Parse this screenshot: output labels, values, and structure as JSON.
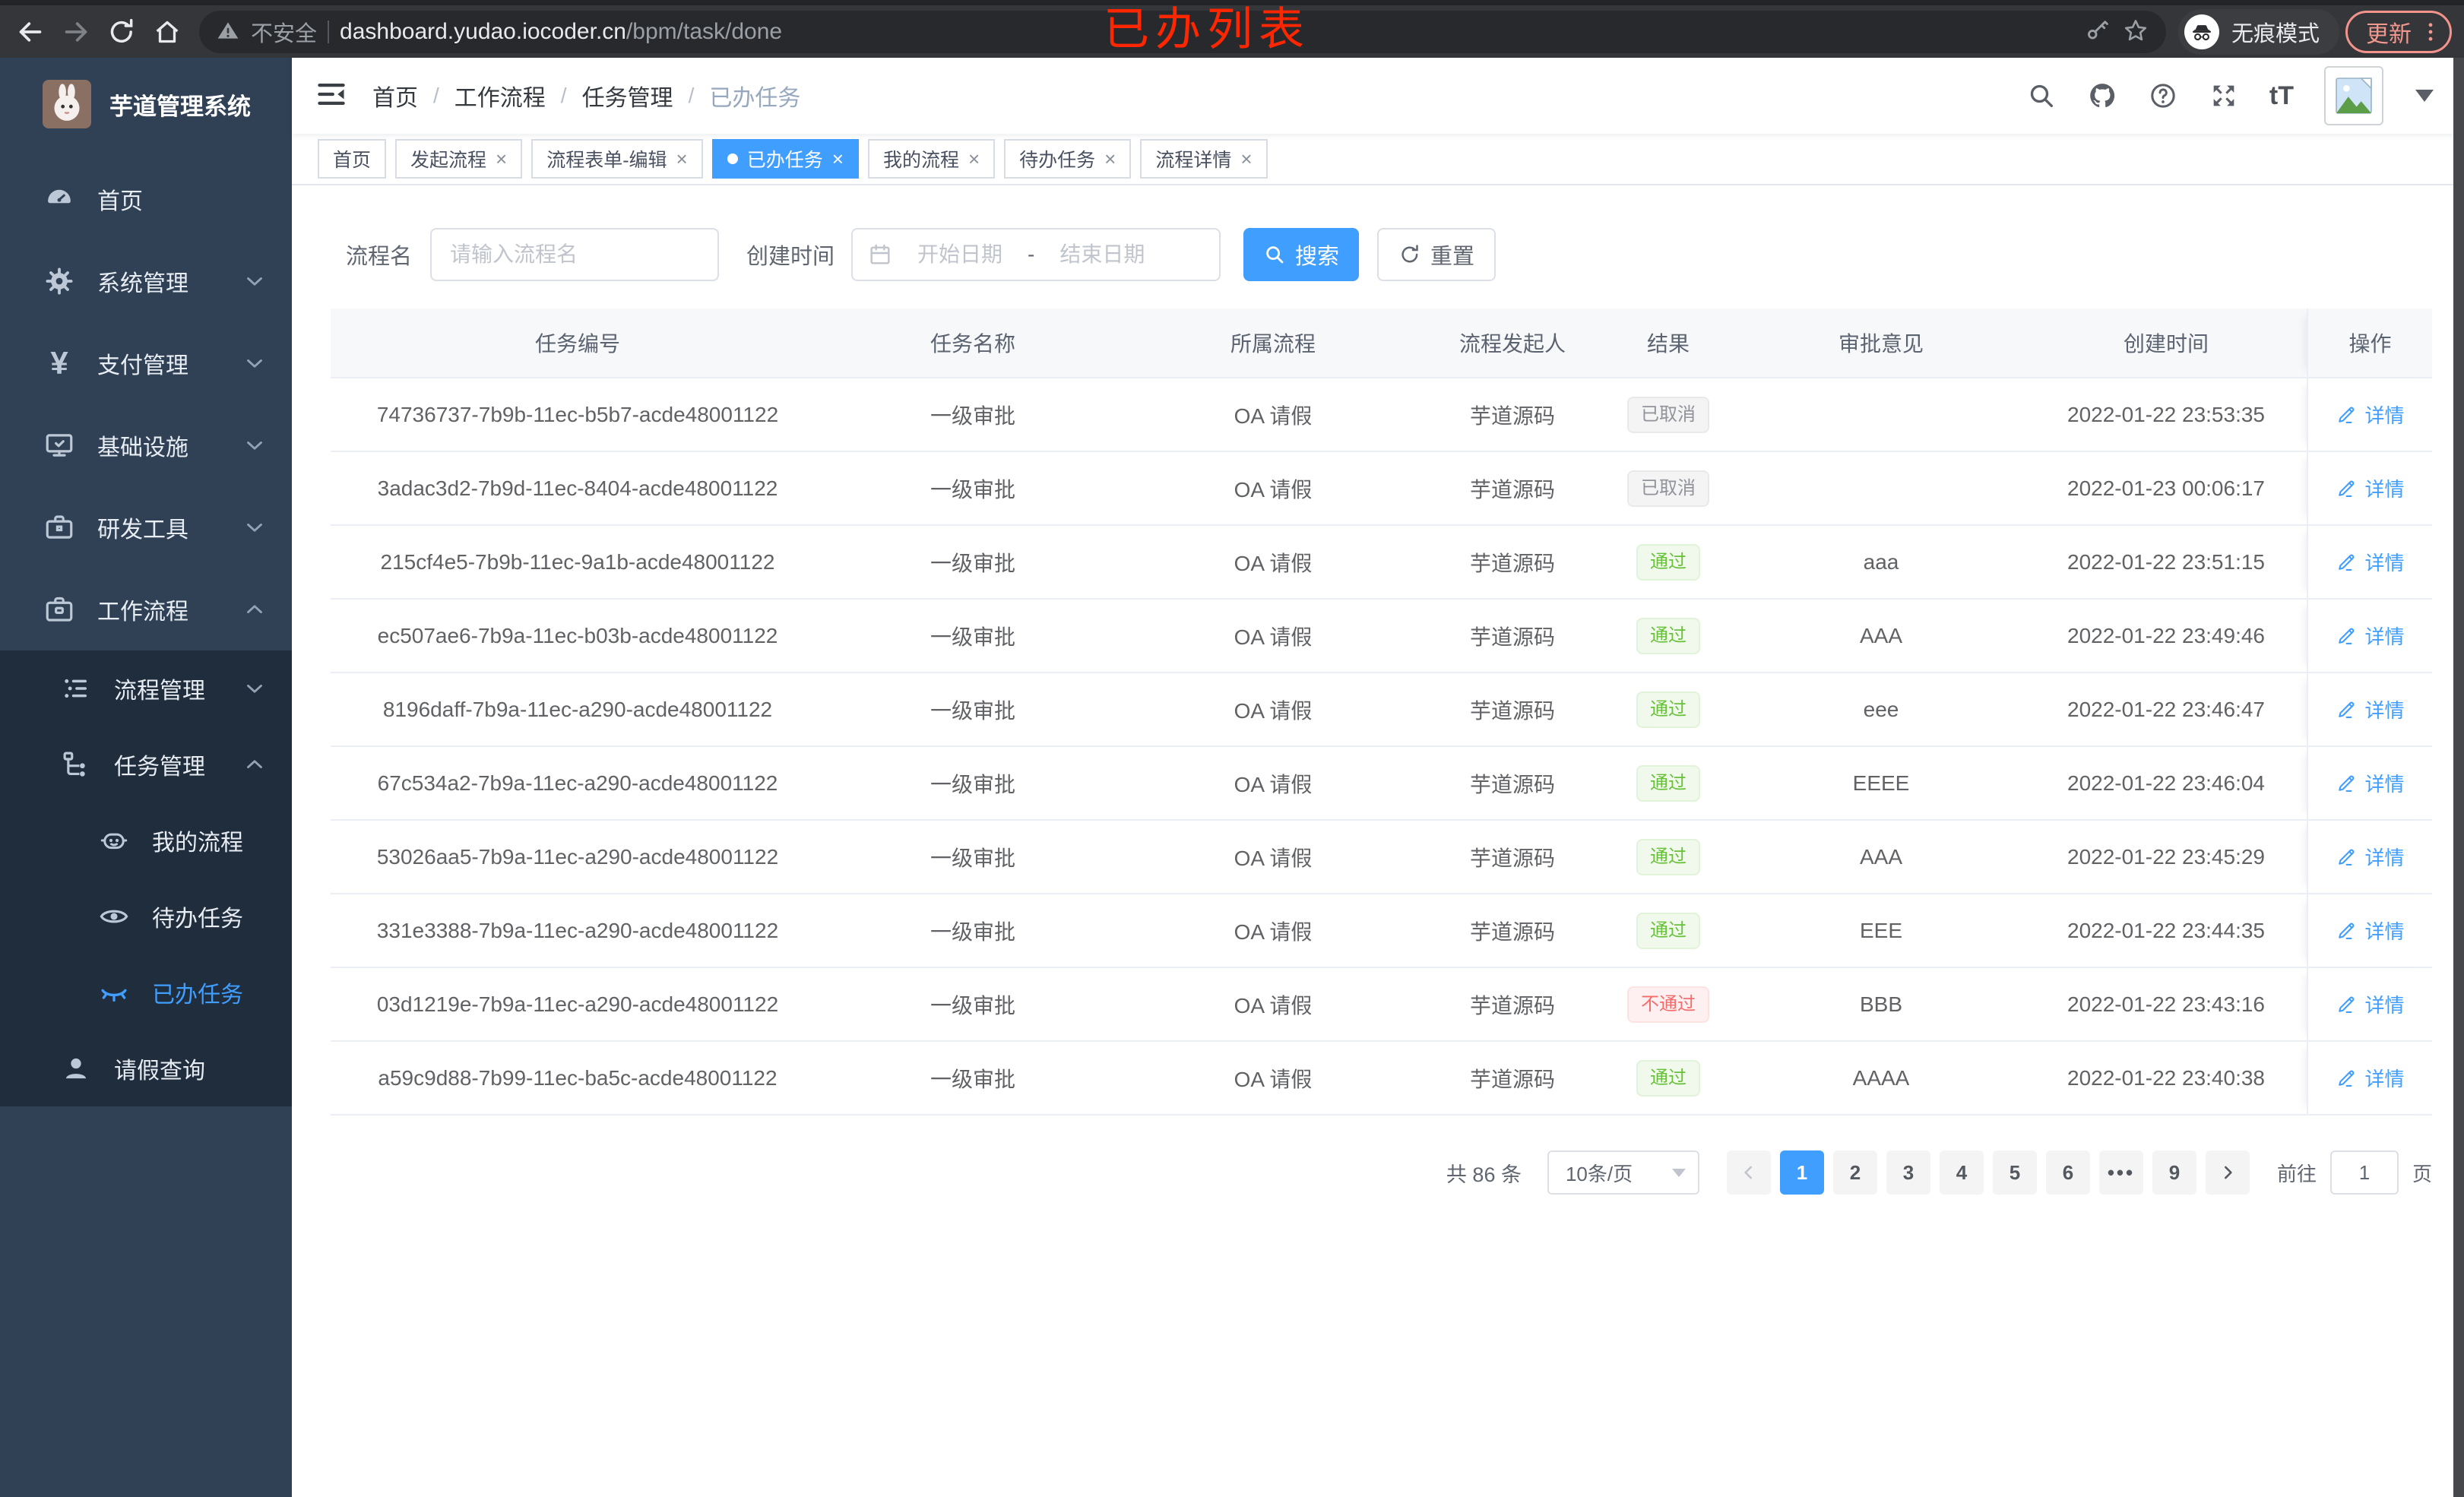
{
  "colors": {
    "accent": "#409eff",
    "success": "#67c23a",
    "danger": "#f56c6c",
    "info": "#909399",
    "annotation": "#ff2600",
    "update_button": "#f2938c",
    "sidebar_bg": "#304156",
    "submenu_bg": "#1f2d3d"
  },
  "browser": {
    "security_label": "不安全",
    "url_host": "dashboard.yudao.iocoder.cn",
    "url_path": "/bpm/task/done",
    "incognito_label": "无痕模式",
    "update_label": "更新",
    "annotation": "已办列表"
  },
  "sidebar": {
    "app_title": "芋道管理系统",
    "menu": [
      {
        "label": "首页",
        "icon": "dashboard",
        "level": 1
      },
      {
        "label": "系统管理",
        "icon": "gear",
        "level": 1,
        "chevron": "down"
      },
      {
        "label": "支付管理",
        "icon": "yen",
        "level": 1,
        "chevron": "down"
      },
      {
        "label": "基础设施",
        "icon": "monitor",
        "level": 1,
        "chevron": "down"
      },
      {
        "label": "研发工具",
        "icon": "toolbox",
        "level": 1,
        "chevron": "down"
      },
      {
        "label": "工作流程",
        "icon": "briefcase",
        "level": 1,
        "chevron": "up"
      },
      {
        "label": "流程管理",
        "icon": "list",
        "level": 2,
        "chevron": "down",
        "sub": true
      },
      {
        "label": "任务管理",
        "icon": "tree",
        "level": 2,
        "chevron": "up",
        "sub": true
      },
      {
        "label": "我的流程",
        "icon": "robot",
        "level": 3,
        "sub": true
      },
      {
        "label": "待办任务",
        "icon": "eye-open",
        "level": 3,
        "sub": true
      },
      {
        "label": "已办任务",
        "icon": "eye-closed",
        "level": 3,
        "sub": true,
        "active": true
      },
      {
        "label": "请假查询",
        "icon": "user",
        "level": 2,
        "sub": true
      }
    ]
  },
  "header": {
    "breadcrumb": [
      {
        "label": "首页"
      },
      {
        "label": "工作流程"
      },
      {
        "label": "任务管理"
      },
      {
        "label": "已办任务",
        "current": true
      }
    ],
    "fontsize_label": "tT"
  },
  "tabs": [
    {
      "label": "首页",
      "closable": false
    },
    {
      "label": "发起流程",
      "closable": true
    },
    {
      "label": "流程表单-编辑",
      "closable": true
    },
    {
      "label": "已办任务",
      "closable": true,
      "active": true
    },
    {
      "label": "我的流程",
      "closable": true
    },
    {
      "label": "待办任务",
      "closable": true
    },
    {
      "label": "流程详情",
      "closable": true
    }
  ],
  "filters": {
    "name_label": "流程名",
    "name_placeholder": "请输入流程名",
    "time_label": "创建时间",
    "start_placeholder": "开始日期",
    "range_separator": "-",
    "end_placeholder": "结束日期",
    "search_label": "搜索",
    "reset_label": "重置"
  },
  "table": {
    "columns": [
      "任务编号",
      "任务名称",
      "所属流程",
      "流程发起人",
      "结果",
      "审批意见",
      "创建时间",
      "操作"
    ],
    "action_label": "详情",
    "rows": [
      {
        "id": "74736737-7b9b-11ec-b5b7-acde48001122",
        "name": "一级审批",
        "process": "OA 请假",
        "starter": "芋道源码",
        "result": "已取消",
        "result_type": "cancelled",
        "comment": "",
        "created": "2022-01-22 23:53:35"
      },
      {
        "id": "3adac3d2-7b9d-11ec-8404-acde48001122",
        "name": "一级审批",
        "process": "OA 请假",
        "starter": "芋道源码",
        "result": "已取消",
        "result_type": "cancelled",
        "comment": "",
        "created": "2022-01-23 00:06:17"
      },
      {
        "id": "215cf4e5-7b9b-11ec-9a1b-acde48001122",
        "name": "一级审批",
        "process": "OA 请假",
        "starter": "芋道源码",
        "result": "通过",
        "result_type": "pass",
        "comment": "aaa",
        "created": "2022-01-22 23:51:15"
      },
      {
        "id": "ec507ae6-7b9a-11ec-b03b-acde48001122",
        "name": "一级审批",
        "process": "OA 请假",
        "starter": "芋道源码",
        "result": "通过",
        "result_type": "pass",
        "comment": "AAA",
        "created": "2022-01-22 23:49:46"
      },
      {
        "id": "8196daff-7b9a-11ec-a290-acde48001122",
        "name": "一级审批",
        "process": "OA 请假",
        "starter": "芋道源码",
        "result": "通过",
        "result_type": "pass",
        "comment": "eee",
        "created": "2022-01-22 23:46:47"
      },
      {
        "id": "67c534a2-7b9a-11ec-a290-acde48001122",
        "name": "一级审批",
        "process": "OA 请假",
        "starter": "芋道源码",
        "result": "通过",
        "result_type": "pass",
        "comment": "EEEE",
        "created": "2022-01-22 23:46:04"
      },
      {
        "id": "53026aa5-7b9a-11ec-a290-acde48001122",
        "name": "一级审批",
        "process": "OA 请假",
        "starter": "芋道源码",
        "result": "通过",
        "result_type": "pass",
        "comment": "AAA",
        "created": "2022-01-22 23:45:29"
      },
      {
        "id": "331e3388-7b9a-11ec-a290-acde48001122",
        "name": "一级审批",
        "process": "OA 请假",
        "starter": "芋道源码",
        "result": "通过",
        "result_type": "pass",
        "comment": "EEE",
        "created": "2022-01-22 23:44:35"
      },
      {
        "id": "03d1219e-7b9a-11ec-a290-acde48001122",
        "name": "一级审批",
        "process": "OA 请假",
        "starter": "芋道源码",
        "result": "不通过",
        "result_type": "fail",
        "comment": "BBB",
        "created": "2022-01-22 23:43:16"
      },
      {
        "id": "a59c9d88-7b99-11ec-ba5c-acde48001122",
        "name": "一级审批",
        "process": "OA 请假",
        "starter": "芋道源码",
        "result": "通过",
        "result_type": "pass",
        "comment": "AAAA",
        "created": "2022-01-22 23:40:38"
      }
    ]
  },
  "pagination": {
    "total": "共 86 条",
    "page_size": "10条/页",
    "pages": [
      "1",
      "2",
      "3",
      "4",
      "5",
      "6",
      "•••",
      "9"
    ],
    "active_page": "1",
    "goto_label": "前往",
    "page_unit": "页",
    "goto_value": "1"
  }
}
